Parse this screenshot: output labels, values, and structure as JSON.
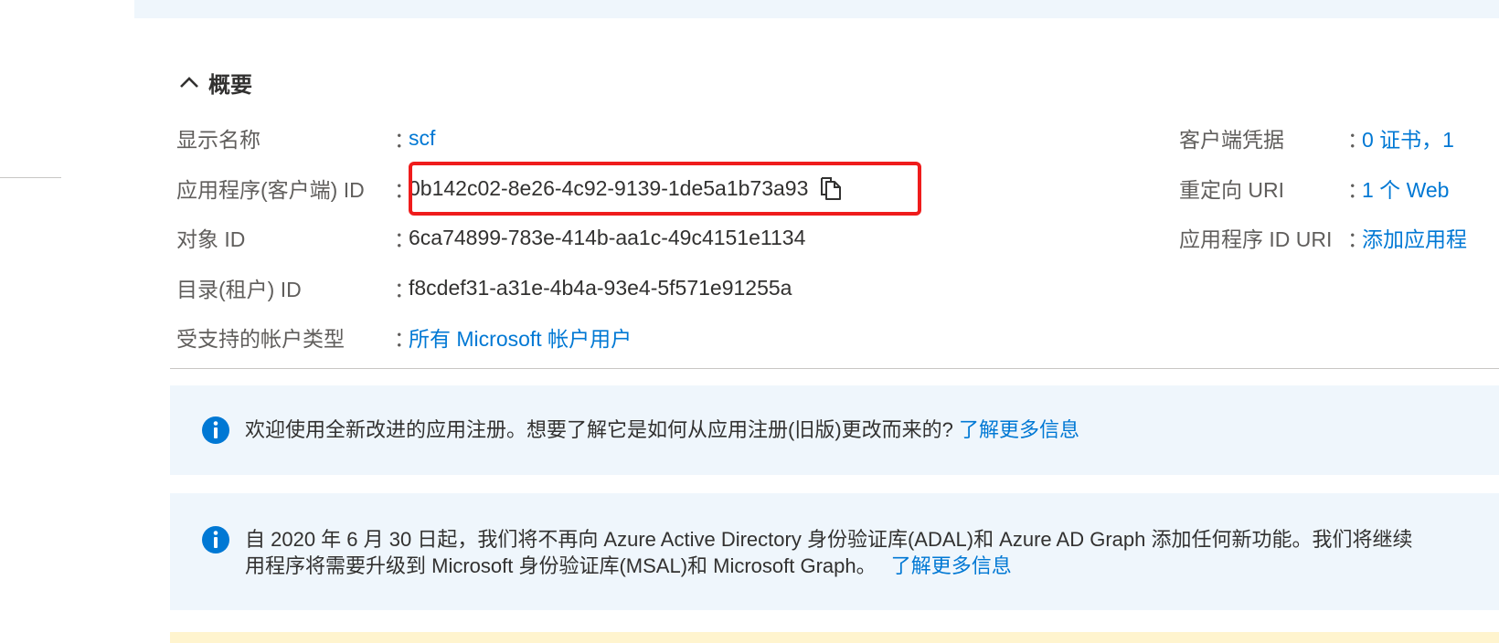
{
  "essentials": {
    "title": "概要",
    "left": {
      "display_name": {
        "label": "显示名称",
        "value": "scf"
      },
      "app_id": {
        "label": "应用程序(客户端) ID",
        "value": "0b142c02-8e26-4c92-9139-1de5a1b73a93"
      },
      "object_id": {
        "label": "对象 ID",
        "value": "6ca74899-783e-414b-aa1c-49c4151e1134"
      },
      "tenant_id": {
        "label": "目录(租户) ID",
        "value": "f8cdef31-a31e-4b4a-93e4-5f571e91255a"
      },
      "account_types": {
        "label": "受支持的帐户类型",
        "value": "所有 Microsoft 帐户用户"
      }
    },
    "right": {
      "client_credentials": {
        "label": "客户端凭据",
        "value": "0 证书，1"
      },
      "redirect_uris": {
        "label": "重定向 URI",
        "value": "1 个 Web"
      },
      "app_id_uri": {
        "label": "应用程序 ID URI",
        "value": "添加应用程"
      }
    },
    "colon": "："
  },
  "banners": {
    "new_experience": {
      "text": "欢迎使用全新改进的应用注册。想要了解它是如何从应用注册(旧版)更改而来的?",
      "link": "了解更多信息"
    },
    "adal": {
      "line1": "自 2020 年 6 月 30 日起，我们将不再向 Azure Active Directory 身份验证库(ADAL)和 Azure AD Graph 添加任何新功能。我们将继续",
      "line2": "用程序将需要升级到 Microsoft 身份验证库(MSAL)和 Microsoft Graph。",
      "link": "了解更多信息"
    }
  },
  "colors": {
    "link": "#0078d4",
    "highlight": "#ef1c1c",
    "info_bg": "#eff6fc"
  }
}
